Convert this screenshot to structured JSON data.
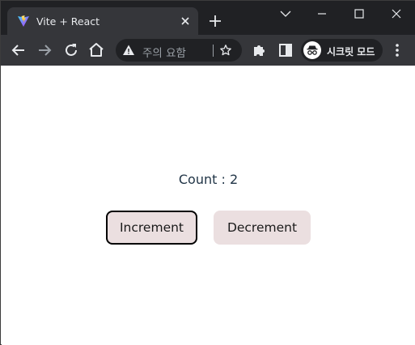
{
  "browser": {
    "tab_title": "Vite + React",
    "address_bar_text": "주의 요함",
    "incognito_label": "시크릿 모드",
    "theme": {
      "frame": "#202124",
      "toolbar": "#35363a",
      "icon": "#e8eaed",
      "muted": "#9aa0a6"
    }
  },
  "icons": {
    "favicon": "vite-logo-icon",
    "tab_close": "close-icon",
    "new_tab": "plus-icon",
    "tab_search": "chevron-down-icon",
    "minimize": "minimize-icon",
    "maximize": "maximize-icon",
    "window_close": "close-icon",
    "back": "arrow-left-icon",
    "forward": "arrow-right-icon",
    "reload": "reload-icon",
    "home": "home-icon",
    "site_info": "warning-triangle-icon",
    "bookmark": "star-icon",
    "extensions": "puzzle-icon",
    "side_panel": "side-panel-icon",
    "incognito": "incognito-icon",
    "menu": "kebab-menu-icon"
  },
  "page": {
    "count_text": "Count : 2",
    "increment_label": "Increment",
    "decrement_label": "Decrement",
    "colors": {
      "text": "#213547",
      "button_bg": "#ebdfe0",
      "focused_border": "#000000"
    }
  }
}
